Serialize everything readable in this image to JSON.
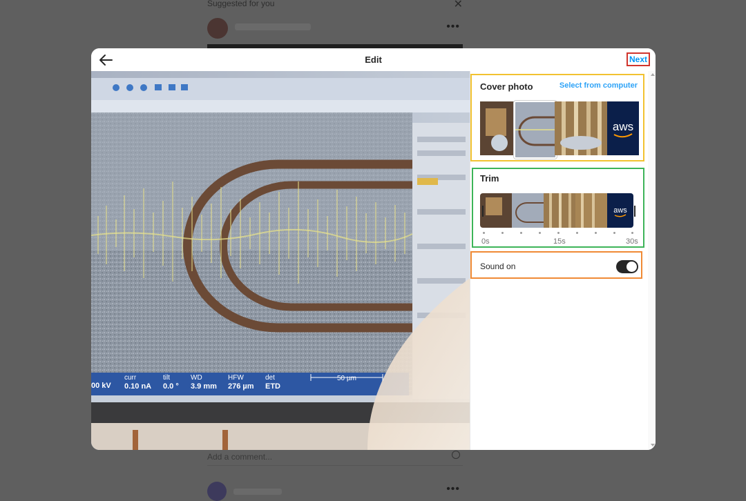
{
  "feed": {
    "suggested_title": "Suggested for you",
    "close_glyph": "✕",
    "more_glyph": "•••",
    "comment_placeholder": "Add a comment..."
  },
  "modal": {
    "title": "Edit",
    "next_label": "Next",
    "back_icon": "arrow-left-icon"
  },
  "preview": {
    "status_bar": {
      "labels": [
        "curr",
        "tilt",
        "WD",
        "HFW",
        "det"
      ],
      "values": [
        "0.10 nA",
        "0.0 °",
        "3.9 mm",
        "276 µm",
        "ETD"
      ],
      "left_value": "00 kV",
      "scale_label": "50 µm"
    }
  },
  "panel": {
    "cover_title": "Cover photo",
    "select_label": "Select from computer",
    "trim_title": "Trim",
    "time_labels": [
      "0s",
      "15s",
      "30s"
    ],
    "sound_label": "Sound on",
    "sound_on": true,
    "thumb_logo_text": "aws"
  },
  "colors": {
    "accent": "#0095f6",
    "next_outline": "#d0342c",
    "cover_outline": "#f2c230",
    "trim_outline": "#3db458",
    "sound_outline": "#f08a35",
    "aws_navy": "#0b1f4a"
  }
}
